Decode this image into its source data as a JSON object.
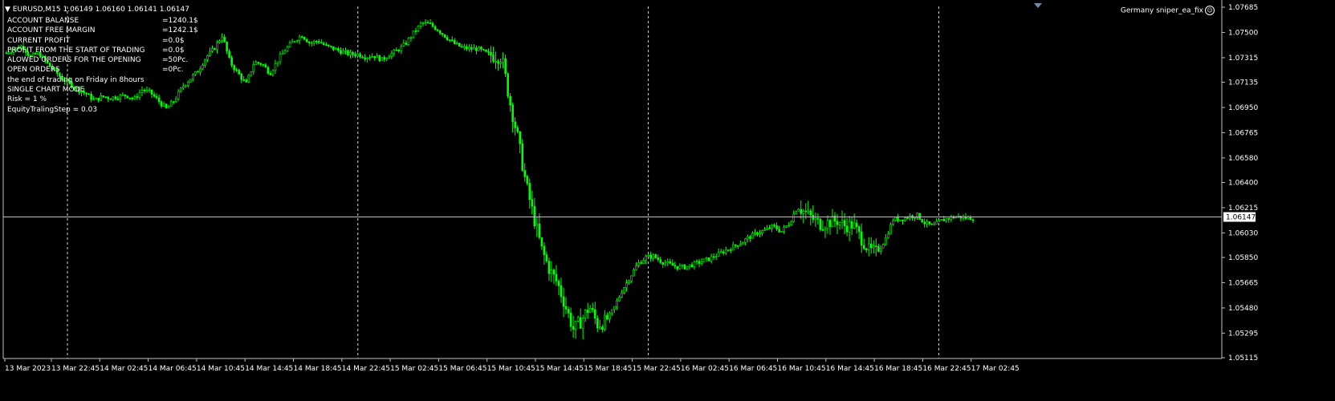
{
  "header": {
    "symbol_label": "EURUSD,M15",
    "ohlc": "1.06149 1.06160 1.06141 1.06147"
  },
  "expert": {
    "name": "Germany sniper_ea_fix",
    "icon": "smiley-icon"
  },
  "info_panel": [
    {
      "label": "ACCOUNT BALANSE",
      "value": "=1240.1$"
    },
    {
      "label": "ACCOUNT FREE MARGIN",
      "value": "=1242.1$"
    },
    {
      "label": "CURRENT PROFIT",
      "value": "=0.0$"
    },
    {
      "label": "PROFIT FROM THE START OF TRADING",
      "value": "=0.0$"
    },
    {
      "label": "ALOWED ORDERS FOR THE OPENING",
      "value": "=50Pc."
    },
    {
      "label": "OPEN ORDERS",
      "value": "=0Pc."
    },
    {
      "label": "the end of trading on Friday in 8hours",
      "value": ""
    },
    {
      "label": "SINGLE CHART MODE",
      "value": ""
    },
    {
      "label": "Risk = 1 %",
      "value": ""
    },
    {
      "label": "EquityTralingStep = 0.03",
      "value": ""
    }
  ],
  "colors": {
    "background": "#000000",
    "candle": "#00ff00",
    "grid": "#ffffff",
    "axis": "#c0c0c0",
    "price_line": "#c0c0c0"
  },
  "chart_data": {
    "type": "line",
    "symbol": "EURUSD",
    "timeframe": "M15",
    "current_price": 1.06147,
    "y_ticks": [
      "1.07685",
      "1.07500",
      "1.07315",
      "1.07135",
      "1.06950",
      "1.06765",
      "1.06580",
      "1.06400",
      "1.06215",
      "1.06030",
      "1.05850",
      "1.05665",
      "1.05480",
      "1.05295",
      "1.05115"
    ],
    "ylim": [
      1.05115,
      1.07685
    ],
    "x_ticks": [
      "13 Mar 2023",
      "13 Mar 22:45",
      "14 Mar 02:45",
      "14 Mar 06:45",
      "14 Mar 10:45",
      "14 Mar 14:45",
      "14 Mar 18:45",
      "14 Mar 22:45",
      "15 Mar 02:45",
      "15 Mar 06:45",
      "15 Mar 10:45",
      "15 Mar 14:45",
      "15 Mar 18:45",
      "15 Mar 22:45",
      "16 Mar 02:45",
      "16 Mar 06:45",
      "16 Mar 10:45",
      "16 Mar 14:45",
      "16 Mar 18:45",
      "16 Mar 22:45",
      "17 Mar 02:45"
    ],
    "day_separators": [
      "13 Mar 22:45",
      "14 Mar 22:45",
      "15 Mar 22:45",
      "16 Mar 22:45"
    ],
    "grid": "period separators only",
    "series": [
      {
        "values": [
          1.0735,
          1.0738,
          1.074,
          1.0732,
          1.0735,
          1.0728,
          1.0722,
          1.0716,
          1.0712,
          1.0708,
          1.0705,
          1.07,
          1.0703,
          1.0702,
          1.0703,
          1.0704,
          1.0701,
          1.0708,
          1.0706,
          1.07,
          1.0694,
          1.07,
          1.071,
          1.0716,
          1.0722,
          1.0732,
          1.0738,
          1.0748,
          1.0728,
          1.072,
          1.0712,
          1.0728,
          1.0727,
          1.072,
          1.073,
          1.0738,
          1.0744,
          1.0748,
          1.0742,
          1.0744,
          1.074,
          1.0738,
          1.0736,
          1.0734,
          1.0734,
          1.0732,
          1.0733,
          1.073,
          1.0734,
          1.0737,
          1.0742,
          1.075,
          1.0757,
          1.0756,
          1.0752,
          1.0747,
          1.0742,
          1.0739,
          1.0738,
          1.0738,
          1.0735,
          1.0733,
          1.0732,
          1.07,
          1.0673,
          1.064,
          1.0615,
          1.0591,
          1.0576,
          1.0566,
          1.0549,
          1.0532,
          1.0539,
          1.0549,
          1.0536,
          1.0538,
          1.0547,
          1.056,
          1.057,
          1.058,
          1.0585,
          1.0586,
          1.0582,
          1.058,
          1.0578,
          1.0578,
          1.058,
          1.0582,
          1.0584,
          1.0587,
          1.059,
          1.0593,
          1.0596,
          1.06,
          1.0603,
          1.0605,
          1.0608,
          1.0604,
          1.061,
          1.0622,
          1.0618,
          1.0613,
          1.0609,
          1.0611,
          1.0612,
          1.0608,
          1.0609,
          1.0599,
          1.059,
          1.0589,
          1.0598,
          1.0613,
          1.0613,
          1.0615,
          1.0616,
          1.061,
          1.0608,
          1.0612,
          1.0614,
          1.0615,
          1.0614,
          1.0614
        ]
      }
    ]
  }
}
